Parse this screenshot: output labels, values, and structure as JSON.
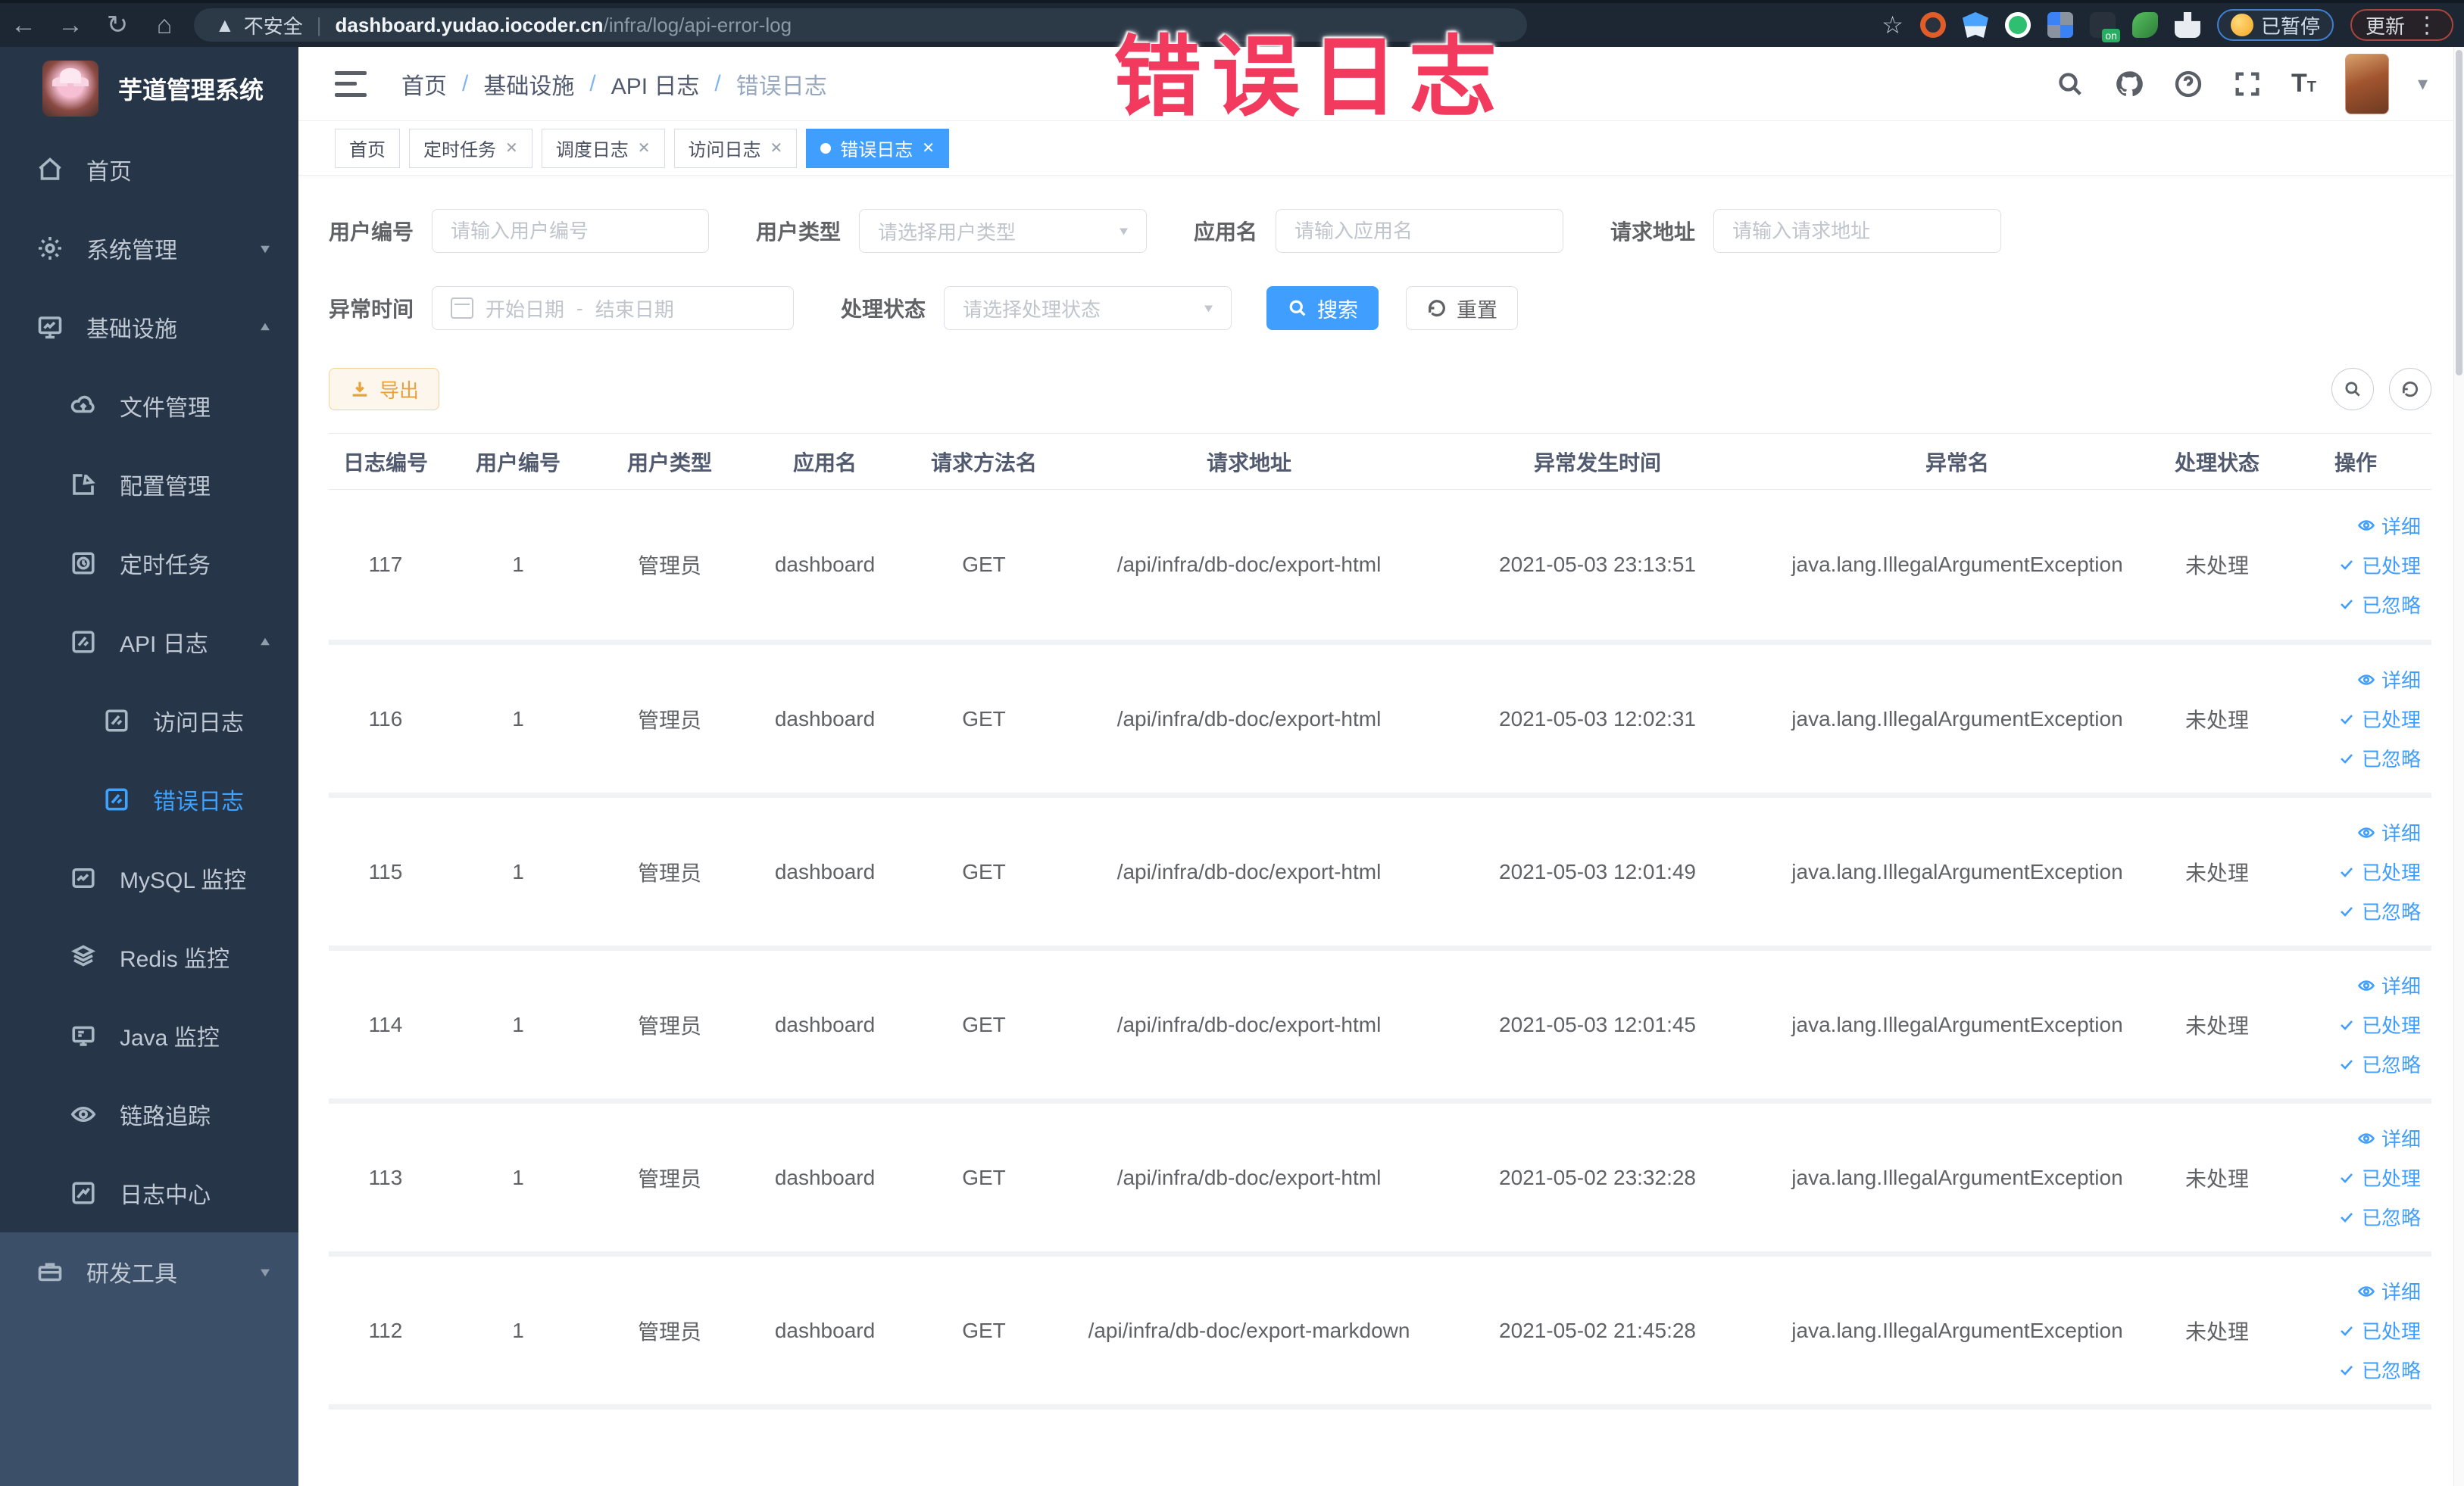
{
  "overlay": {
    "title": "错误日志"
  },
  "browser": {
    "security_label": "不安全",
    "url_host": "dashboard.yudao.iocoder.cn",
    "url_path": "/infra/log/api-error-log",
    "paused_label": "已暂停",
    "update_label": "更新",
    "on_badge": "on"
  },
  "sidebar": {
    "title": "芋道管理系统",
    "items": [
      {
        "label": "首页"
      },
      {
        "label": "系统管理"
      },
      {
        "label": "基础设施"
      },
      {
        "label": "文件管理"
      },
      {
        "label": "配置管理"
      },
      {
        "label": "定时任务"
      },
      {
        "label": "API 日志"
      },
      {
        "label": "访问日志"
      },
      {
        "label": "错误日志"
      },
      {
        "label": "MySQL 监控"
      },
      {
        "label": "Redis 监控"
      },
      {
        "label": "Java 监控"
      },
      {
        "label": "链路追踪"
      },
      {
        "label": "日志中心"
      },
      {
        "label": "研发工具"
      }
    ]
  },
  "header": {
    "breadcrumb": [
      "首页",
      "基础设施",
      "API 日志",
      "错误日志"
    ]
  },
  "tabs": [
    {
      "label": "首页"
    },
    {
      "label": "定时任务"
    },
    {
      "label": "调度日志"
    },
    {
      "label": "访问日志"
    },
    {
      "label": "错误日志"
    }
  ],
  "filters": {
    "user_id": {
      "label": "用户编号",
      "placeholder": "请输入用户编号"
    },
    "user_type": {
      "label": "用户类型",
      "placeholder": "请选择用户类型"
    },
    "app_name": {
      "label": "应用名",
      "placeholder": "请输入应用名"
    },
    "request_url": {
      "label": "请求地址",
      "placeholder": "请输入请求地址"
    },
    "exception_time": {
      "label": "异常时间",
      "start_placeholder": "开始日期",
      "separator": "-",
      "end_placeholder": "结束日期"
    },
    "process_status": {
      "label": "处理状态",
      "placeholder": "请选择处理状态"
    },
    "search_label": "搜索",
    "reset_label": "重置"
  },
  "toolbar": {
    "export_label": "导出"
  },
  "table": {
    "columns": [
      "日志编号",
      "用户编号",
      "用户类型",
      "应用名",
      "请求方法名",
      "请求地址",
      "异常发生时间",
      "异常名",
      "处理状态",
      "操作"
    ],
    "action_labels": {
      "detail": "详细",
      "processed": "已处理",
      "ignored": "已忽略"
    },
    "rows": [
      {
        "id": "117",
        "user_id": "1",
        "user_type": "管理员",
        "app": "dashboard",
        "method": "GET",
        "url": "/api/infra/db-doc/export-html",
        "time": "2021-05-03 23:13:51",
        "exception": "java.lang.IllegalArgumentException",
        "status": "未处理"
      },
      {
        "id": "116",
        "user_id": "1",
        "user_type": "管理员",
        "app": "dashboard",
        "method": "GET",
        "url": "/api/infra/db-doc/export-html",
        "time": "2021-05-03 12:02:31",
        "exception": "java.lang.IllegalArgumentException",
        "status": "未处理"
      },
      {
        "id": "115",
        "user_id": "1",
        "user_type": "管理员",
        "app": "dashboard",
        "method": "GET",
        "url": "/api/infra/db-doc/export-html",
        "time": "2021-05-03 12:01:49",
        "exception": "java.lang.IllegalArgumentException",
        "status": "未处理"
      },
      {
        "id": "114",
        "user_id": "1",
        "user_type": "管理员",
        "app": "dashboard",
        "method": "GET",
        "url": "/api/infra/db-doc/export-html",
        "time": "2021-05-03 12:01:45",
        "exception": "java.lang.IllegalArgumentException",
        "status": "未处理"
      },
      {
        "id": "113",
        "user_id": "1",
        "user_type": "管理员",
        "app": "dashboard",
        "method": "GET",
        "url": "/api/infra/db-doc/export-html",
        "time": "2021-05-02 23:32:28",
        "exception": "java.lang.IllegalArgumentException",
        "status": "未处理"
      },
      {
        "id": "112",
        "user_id": "1",
        "user_type": "管理员",
        "app": "dashboard",
        "method": "GET",
        "url": "/api/infra/db-doc/export-markdown",
        "time": "2021-05-02 21:45:28",
        "exception": "java.lang.IllegalArgumentException",
        "status": "未处理"
      }
    ]
  }
}
